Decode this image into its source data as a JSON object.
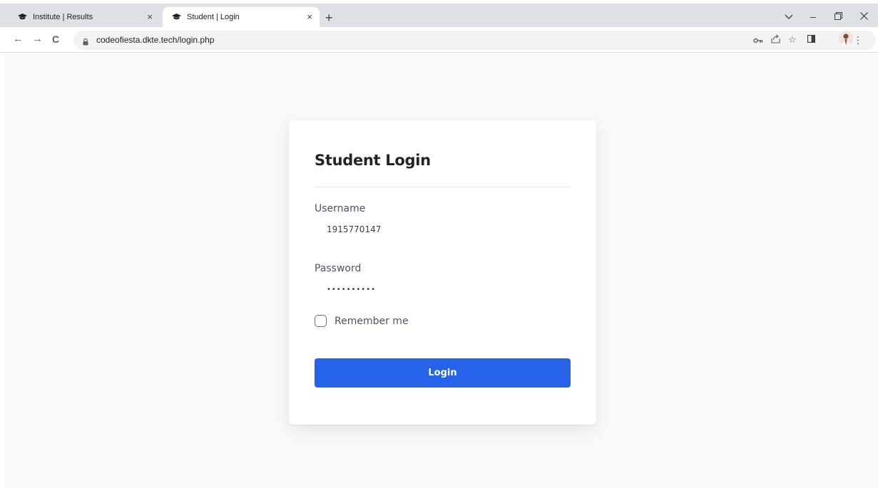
{
  "browser": {
    "tabs": [
      {
        "label": "Institute | Results",
        "close": "×"
      },
      {
        "label": "Student | Login",
        "close": "×"
      }
    ],
    "new_tab": "+",
    "window_controls": {
      "dropdown": "⌄",
      "minimize": "–",
      "restore": "❐",
      "close": "✕"
    },
    "nav": {
      "back": "←",
      "forward": "→",
      "reload": "C"
    },
    "url": "codeofiesta.dkte.tech/login.php",
    "toolbar_icons": [
      "key-icon",
      "share-icon",
      "star-icon",
      "sidepanel-icon",
      "profile-avatar",
      "kebab-menu-icon"
    ],
    "accent": "#dee1e6"
  },
  "login": {
    "title": "Student Login",
    "username_label": "Username",
    "username_value": "1915770147",
    "password_label": "Password",
    "password_value": "••••••••••",
    "remember_label": "Remember me",
    "remember_checked": false,
    "submit_label": "Login",
    "button_color": "#2563eb",
    "background": "#f8f9fb"
  }
}
